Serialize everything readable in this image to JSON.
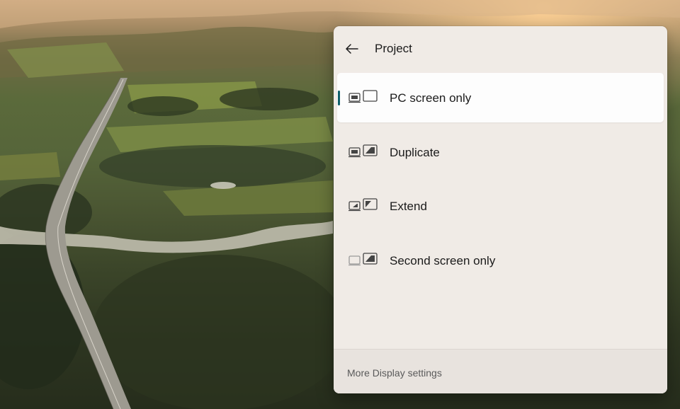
{
  "panel": {
    "title": "Project",
    "back_icon": "back-arrow-icon",
    "options": [
      {
        "label": "PC screen only",
        "icon": "pc-screen-only-icon",
        "selected": true
      },
      {
        "label": "Duplicate",
        "icon": "duplicate-icon",
        "selected": false
      },
      {
        "label": "Extend",
        "icon": "extend-icon",
        "selected": false
      },
      {
        "label": "Second screen only",
        "icon": "second-screen-only-icon",
        "selected": false
      }
    ],
    "footer_link": "More Display settings"
  },
  "colors": {
    "panel_background": "#f0ebe6",
    "selected_background": "#fdfdfd",
    "accent_indicator": "#0f5f6b",
    "text": "#1b1b1b",
    "footer_text": "#5a5a5a"
  }
}
